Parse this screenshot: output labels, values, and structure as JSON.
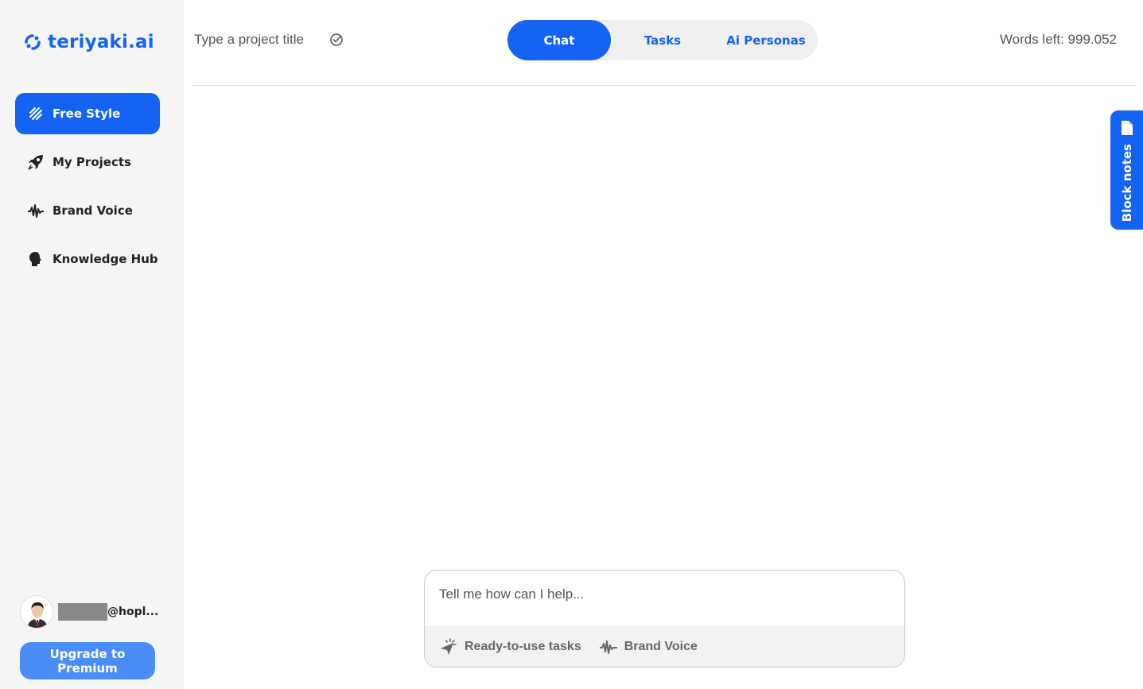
{
  "app": {
    "logo_text": "teriyaki.ai",
    "brand_color": "#1463f3"
  },
  "sidebar": {
    "items": [
      {
        "label": "Free Style",
        "icon": "free-style-icon",
        "active": true
      },
      {
        "label": "My Projects",
        "icon": "rocket-icon",
        "active": false
      },
      {
        "label": "Brand Voice",
        "icon": "waveform-icon",
        "active": false
      },
      {
        "label": "Knowledge Hub",
        "icon": "head-icon",
        "active": false
      }
    ],
    "user": {
      "email_suffix": "@hopl..."
    },
    "upgrade_label": "Upgrade to Premium"
  },
  "header": {
    "project_title_placeholder": "Type a project title",
    "tabs": [
      {
        "label": "Chat",
        "active": true
      },
      {
        "label": "Tasks",
        "active": false
      },
      {
        "label": "Ai Personas",
        "active": false
      }
    ],
    "words_left": "Words left: 999.052"
  },
  "block_notes": {
    "label": "Block notes"
  },
  "composer": {
    "placeholder": "Tell me how can I help...",
    "tasks_label": "Ready-to-use tasks",
    "brand_voice_label": "Brand Voice"
  }
}
